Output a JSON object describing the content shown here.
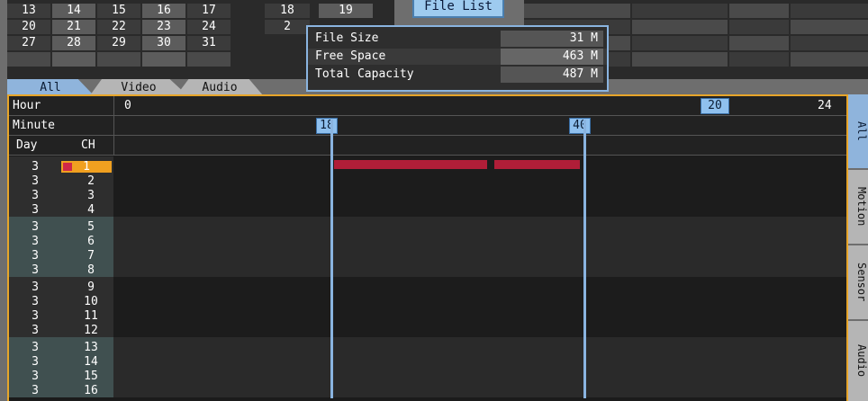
{
  "calendar": {
    "rows": [
      [
        "13",
        "14",
        "15",
        "16",
        "17",
        "18",
        "19"
      ],
      [
        "20",
        "21",
        "22",
        "23",
        "24",
        "2",
        ""
      ],
      [
        "27",
        "28",
        "29",
        "30",
        "31",
        "",
        ""
      ]
    ]
  },
  "file_list": {
    "button_label": "File List",
    "file_size_label": "File Size",
    "file_size_value": "31 M",
    "free_space_label": "Free Space",
    "free_space_value": "463 M",
    "total_capacity_label": "Total Capacity",
    "total_capacity_value": "487 M"
  },
  "tabs": {
    "all": "All",
    "video": "Video",
    "audio": "Audio"
  },
  "timeline": {
    "hour_label": "Hour",
    "minute_label": "Minute",
    "day_label": "Day",
    "ch_label": "CH",
    "hour_start": "0",
    "hour_end": "24",
    "hour_marker": "20",
    "minute_start_marker": "18",
    "minute_end_marker": "40",
    "selected_channel": "1",
    "day": "3",
    "channels": [
      "1",
      "2",
      "3",
      "4",
      "5",
      "6",
      "7",
      "8",
      "9",
      "10",
      "11",
      "12",
      "13",
      "14",
      "15",
      "16"
    ],
    "recordings": [
      {
        "channel": "1",
        "type": "event"
      }
    ]
  },
  "side_tabs": {
    "all": "All",
    "motion": "Motion",
    "sensor": "Sensor",
    "audio": "Audio"
  },
  "colors": {
    "accent_border": "#e7a52a",
    "marker": "#8fc0ee",
    "recording": "#b01e38",
    "selected_channel": "#f0a020"
  }
}
